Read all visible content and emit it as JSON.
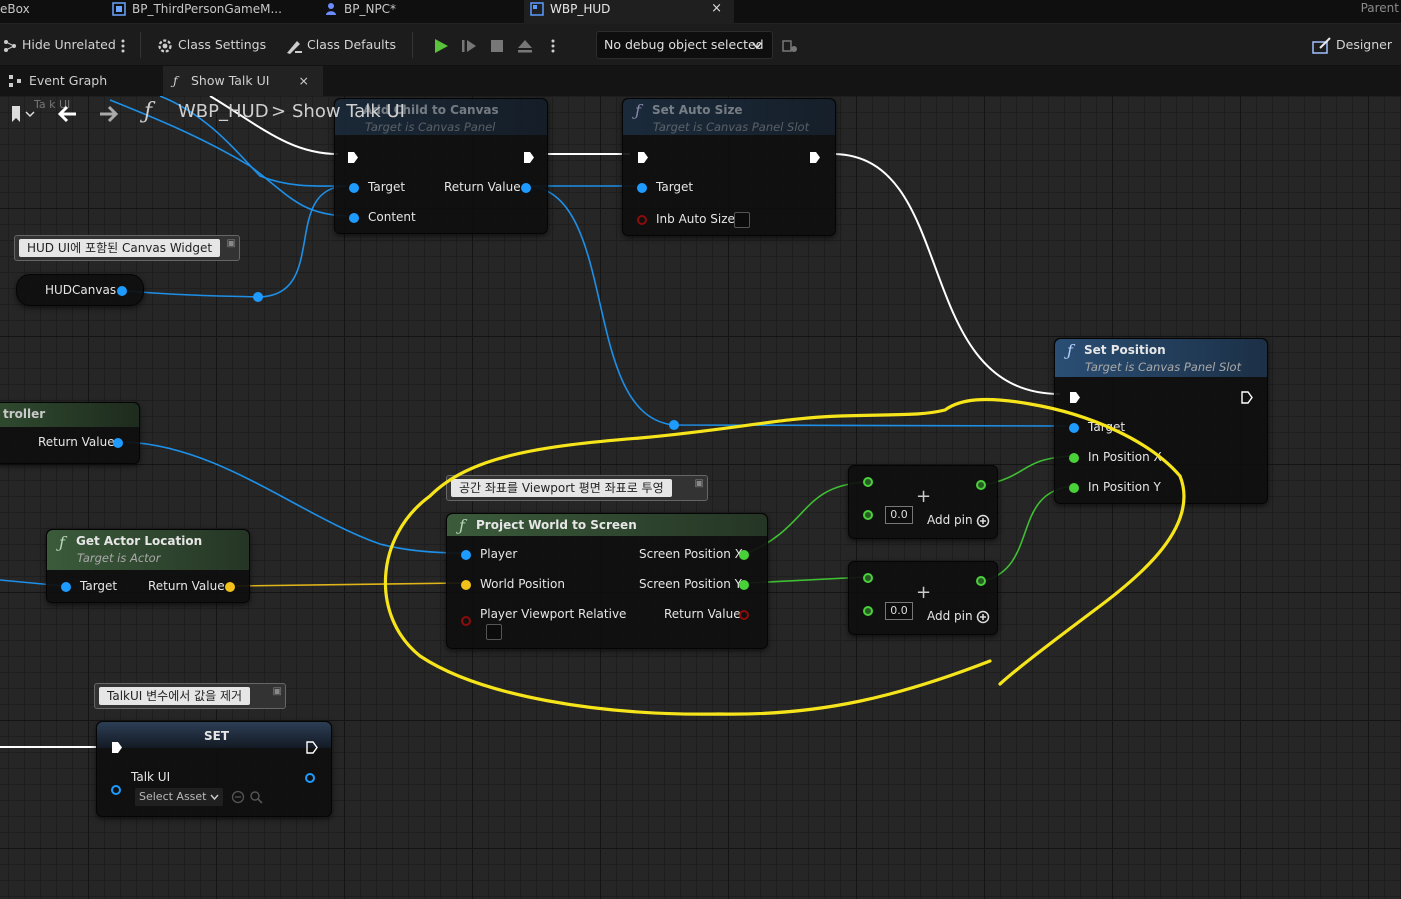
{
  "tabs": [
    {
      "label": "eBox"
    },
    {
      "label": "BP_ThirdPersonGameM..."
    },
    {
      "label": "BP_NPC*"
    },
    {
      "label": "WBP_HUD",
      "active": true
    }
  ],
  "tab_close": "×",
  "parent_label": "Parent",
  "toolbar": {
    "hide_unrelated": "Hide Unrelated",
    "class_settings": "Class Settings",
    "class_defaults": "Class Defaults",
    "debug_object": "No debug object selected",
    "designer": "Designer"
  },
  "graph_tabs": [
    {
      "label": "Event Graph"
    },
    {
      "label": "Show Talk UI",
      "active": true
    }
  ],
  "breadcrumb": {
    "root": "WBP_HUD",
    "separator": ">",
    "current": "Show Talk UI",
    "ghost_left": "Ta k UI"
  },
  "nodes": {
    "add_child": {
      "title": "Add Child to Canvas",
      "subtitle": "Target is Canvas Panel",
      "pins": {
        "target": "Target",
        "content": "Content",
        "return_value": "Return Value"
      }
    },
    "set_auto_size": {
      "title": "Set Auto Size",
      "subtitle": "Target is Canvas Panel Slot",
      "pins": {
        "target": "Target",
        "auto_size": "Inb Auto Size"
      }
    },
    "hud_canvas": {
      "label": "HUDCanvas"
    },
    "controller": {
      "title": "troller",
      "return_value": "Return Value"
    },
    "get_actor_location": {
      "title": "Get Actor Location",
      "subtitle": "Target is Actor",
      "pins": {
        "target": "Target",
        "return_value": "Return Value"
      }
    },
    "project_world": {
      "title": "Project World to Screen",
      "pins": {
        "player": "Player",
        "world_position": "World Position",
        "viewport_relative": "Player Viewport Relative",
        "screen_x": "Screen Position X",
        "screen_y": "Screen Position Y",
        "return_value": "Return Value"
      }
    },
    "add_node_1": {
      "value": "0.0",
      "add_pin": "Add pin",
      "plus": "+"
    },
    "add_node_2": {
      "value": "0.0",
      "add_pin": "Add pin",
      "plus": "+"
    },
    "set_position": {
      "title": "Set Position",
      "subtitle": "Target is Canvas Panel Slot",
      "pins": {
        "target": "Target",
        "in_x": "In Position X",
        "in_y": "In Position Y"
      }
    },
    "set_node": {
      "title": "SET",
      "var": "Talk UI",
      "select": "Select Asset"
    }
  },
  "comments": {
    "hud_canvas": "HUD UI에 포함된 Canvas Widget",
    "project": "공간 좌표를 Viewport 평면 좌표로 투영",
    "set_talk": "TalkUI 변수에서 값을 제거"
  },
  "colors": {
    "exec_wire": "#ffffff",
    "object_wire": "#1e9bff",
    "float_wire": "#49d13a",
    "vector_wire": "#f1c21a",
    "annotation": "#f7e51b"
  }
}
